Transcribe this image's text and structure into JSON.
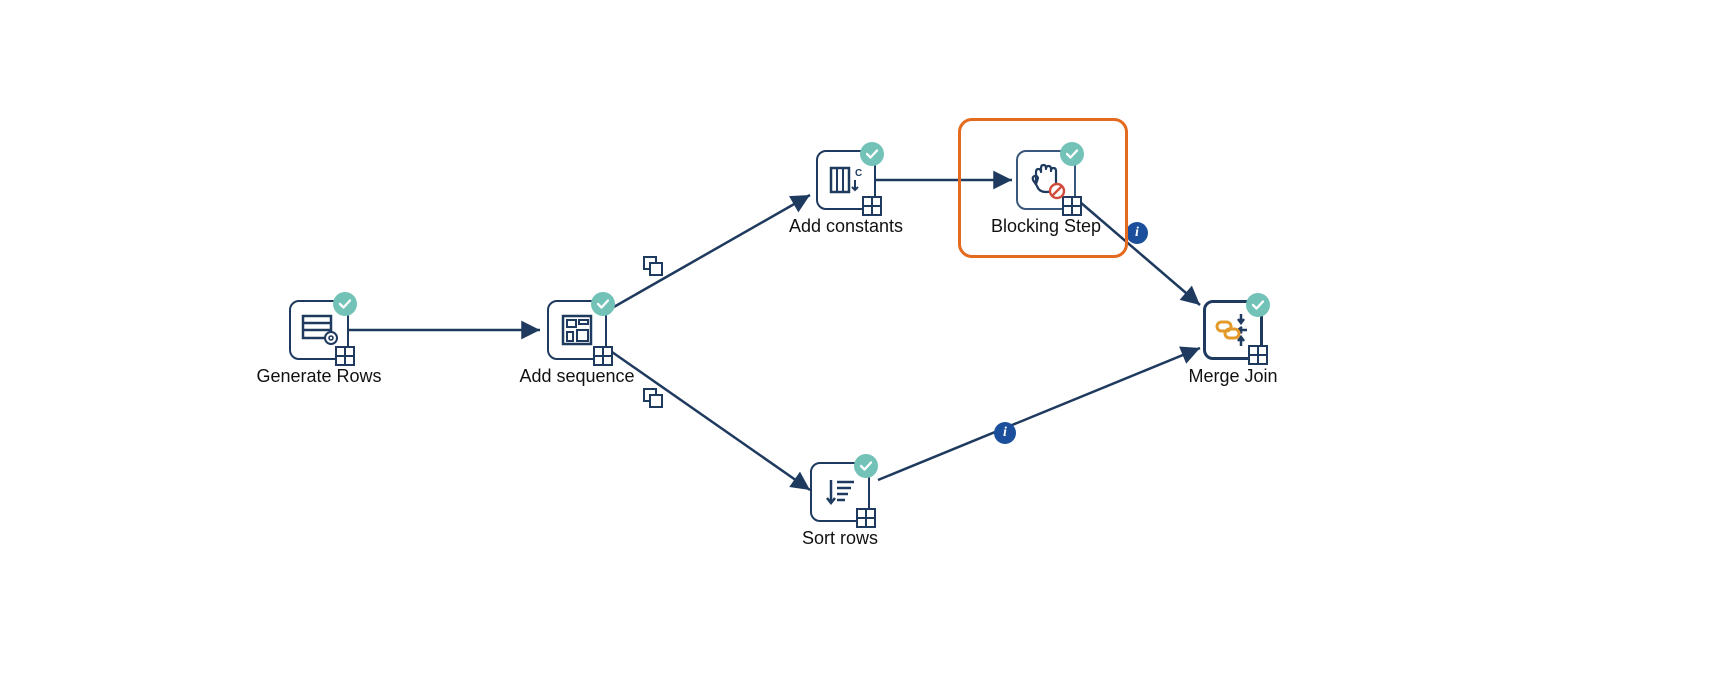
{
  "diagram": {
    "nodes": {
      "generate_rows": {
        "label": "Generate Rows"
      },
      "add_sequence": {
        "label": "Add sequence"
      },
      "add_constants": {
        "label": "Add constants"
      },
      "blocking_step": {
        "label": "Blocking Step"
      },
      "sort_rows": {
        "label": "Sort rows"
      },
      "merge_join": {
        "label": "Merge Join"
      }
    },
    "selected_node": "blocking_step",
    "hops": [
      {
        "from": "generate_rows",
        "to": "add_sequence"
      },
      {
        "from": "add_sequence",
        "to": "add_constants",
        "distribute": true
      },
      {
        "from": "add_sequence",
        "to": "sort_rows",
        "distribute": true
      },
      {
        "from": "add_constants",
        "to": "blocking_step"
      },
      {
        "from": "blocking_step",
        "to": "merge_join",
        "info": true
      },
      {
        "from": "sort_rows",
        "to": "merge_join",
        "info": true
      }
    ]
  },
  "colors": {
    "stroke": "#1f3a5f",
    "check": "#73c2b8",
    "info": "#1b4f9c",
    "select": "#e46a1f",
    "block": "#d14b3a",
    "join": "#e39a2a"
  }
}
